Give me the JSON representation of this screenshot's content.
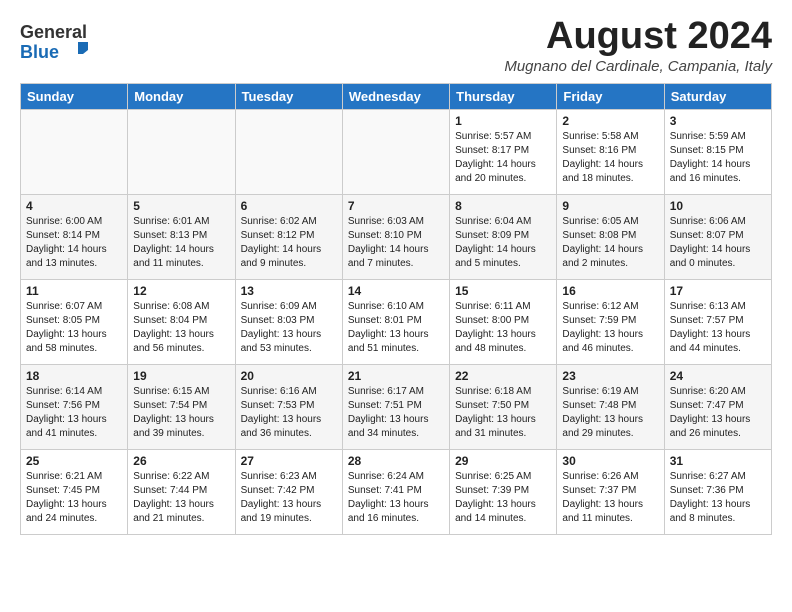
{
  "header": {
    "logo_general": "General",
    "logo_blue": "Blue",
    "month_year": "August 2024",
    "location": "Mugnano del Cardinale, Campania, Italy"
  },
  "weekdays": [
    "Sunday",
    "Monday",
    "Tuesday",
    "Wednesday",
    "Thursday",
    "Friday",
    "Saturday"
  ],
  "weeks": [
    [
      {
        "day": "",
        "info": ""
      },
      {
        "day": "",
        "info": ""
      },
      {
        "day": "",
        "info": ""
      },
      {
        "day": "",
        "info": ""
      },
      {
        "day": "1",
        "info": "Sunrise: 5:57 AM\nSunset: 8:17 PM\nDaylight: 14 hours\nand 20 minutes."
      },
      {
        "day": "2",
        "info": "Sunrise: 5:58 AM\nSunset: 8:16 PM\nDaylight: 14 hours\nand 18 minutes."
      },
      {
        "day": "3",
        "info": "Sunrise: 5:59 AM\nSunset: 8:15 PM\nDaylight: 14 hours\nand 16 minutes."
      }
    ],
    [
      {
        "day": "4",
        "info": "Sunrise: 6:00 AM\nSunset: 8:14 PM\nDaylight: 14 hours\nand 13 minutes."
      },
      {
        "day": "5",
        "info": "Sunrise: 6:01 AM\nSunset: 8:13 PM\nDaylight: 14 hours\nand 11 minutes."
      },
      {
        "day": "6",
        "info": "Sunrise: 6:02 AM\nSunset: 8:12 PM\nDaylight: 14 hours\nand 9 minutes."
      },
      {
        "day": "7",
        "info": "Sunrise: 6:03 AM\nSunset: 8:10 PM\nDaylight: 14 hours\nand 7 minutes."
      },
      {
        "day": "8",
        "info": "Sunrise: 6:04 AM\nSunset: 8:09 PM\nDaylight: 14 hours\nand 5 minutes."
      },
      {
        "day": "9",
        "info": "Sunrise: 6:05 AM\nSunset: 8:08 PM\nDaylight: 14 hours\nand 2 minutes."
      },
      {
        "day": "10",
        "info": "Sunrise: 6:06 AM\nSunset: 8:07 PM\nDaylight: 14 hours\nand 0 minutes."
      }
    ],
    [
      {
        "day": "11",
        "info": "Sunrise: 6:07 AM\nSunset: 8:05 PM\nDaylight: 13 hours\nand 58 minutes."
      },
      {
        "day": "12",
        "info": "Sunrise: 6:08 AM\nSunset: 8:04 PM\nDaylight: 13 hours\nand 56 minutes."
      },
      {
        "day": "13",
        "info": "Sunrise: 6:09 AM\nSunset: 8:03 PM\nDaylight: 13 hours\nand 53 minutes."
      },
      {
        "day": "14",
        "info": "Sunrise: 6:10 AM\nSunset: 8:01 PM\nDaylight: 13 hours\nand 51 minutes."
      },
      {
        "day": "15",
        "info": "Sunrise: 6:11 AM\nSunset: 8:00 PM\nDaylight: 13 hours\nand 48 minutes."
      },
      {
        "day": "16",
        "info": "Sunrise: 6:12 AM\nSunset: 7:59 PM\nDaylight: 13 hours\nand 46 minutes."
      },
      {
        "day": "17",
        "info": "Sunrise: 6:13 AM\nSunset: 7:57 PM\nDaylight: 13 hours\nand 44 minutes."
      }
    ],
    [
      {
        "day": "18",
        "info": "Sunrise: 6:14 AM\nSunset: 7:56 PM\nDaylight: 13 hours\nand 41 minutes."
      },
      {
        "day": "19",
        "info": "Sunrise: 6:15 AM\nSunset: 7:54 PM\nDaylight: 13 hours\nand 39 minutes."
      },
      {
        "day": "20",
        "info": "Sunrise: 6:16 AM\nSunset: 7:53 PM\nDaylight: 13 hours\nand 36 minutes."
      },
      {
        "day": "21",
        "info": "Sunrise: 6:17 AM\nSunset: 7:51 PM\nDaylight: 13 hours\nand 34 minutes."
      },
      {
        "day": "22",
        "info": "Sunrise: 6:18 AM\nSunset: 7:50 PM\nDaylight: 13 hours\nand 31 minutes."
      },
      {
        "day": "23",
        "info": "Sunrise: 6:19 AM\nSunset: 7:48 PM\nDaylight: 13 hours\nand 29 minutes."
      },
      {
        "day": "24",
        "info": "Sunrise: 6:20 AM\nSunset: 7:47 PM\nDaylight: 13 hours\nand 26 minutes."
      }
    ],
    [
      {
        "day": "25",
        "info": "Sunrise: 6:21 AM\nSunset: 7:45 PM\nDaylight: 13 hours\nand 24 minutes."
      },
      {
        "day": "26",
        "info": "Sunrise: 6:22 AM\nSunset: 7:44 PM\nDaylight: 13 hours\nand 21 minutes."
      },
      {
        "day": "27",
        "info": "Sunrise: 6:23 AM\nSunset: 7:42 PM\nDaylight: 13 hours\nand 19 minutes."
      },
      {
        "day": "28",
        "info": "Sunrise: 6:24 AM\nSunset: 7:41 PM\nDaylight: 13 hours\nand 16 minutes."
      },
      {
        "day": "29",
        "info": "Sunrise: 6:25 AM\nSunset: 7:39 PM\nDaylight: 13 hours\nand 14 minutes."
      },
      {
        "day": "30",
        "info": "Sunrise: 6:26 AM\nSunset: 7:37 PM\nDaylight: 13 hours\nand 11 minutes."
      },
      {
        "day": "31",
        "info": "Sunrise: 6:27 AM\nSunset: 7:36 PM\nDaylight: 13 hours\nand 8 minutes."
      }
    ]
  ]
}
